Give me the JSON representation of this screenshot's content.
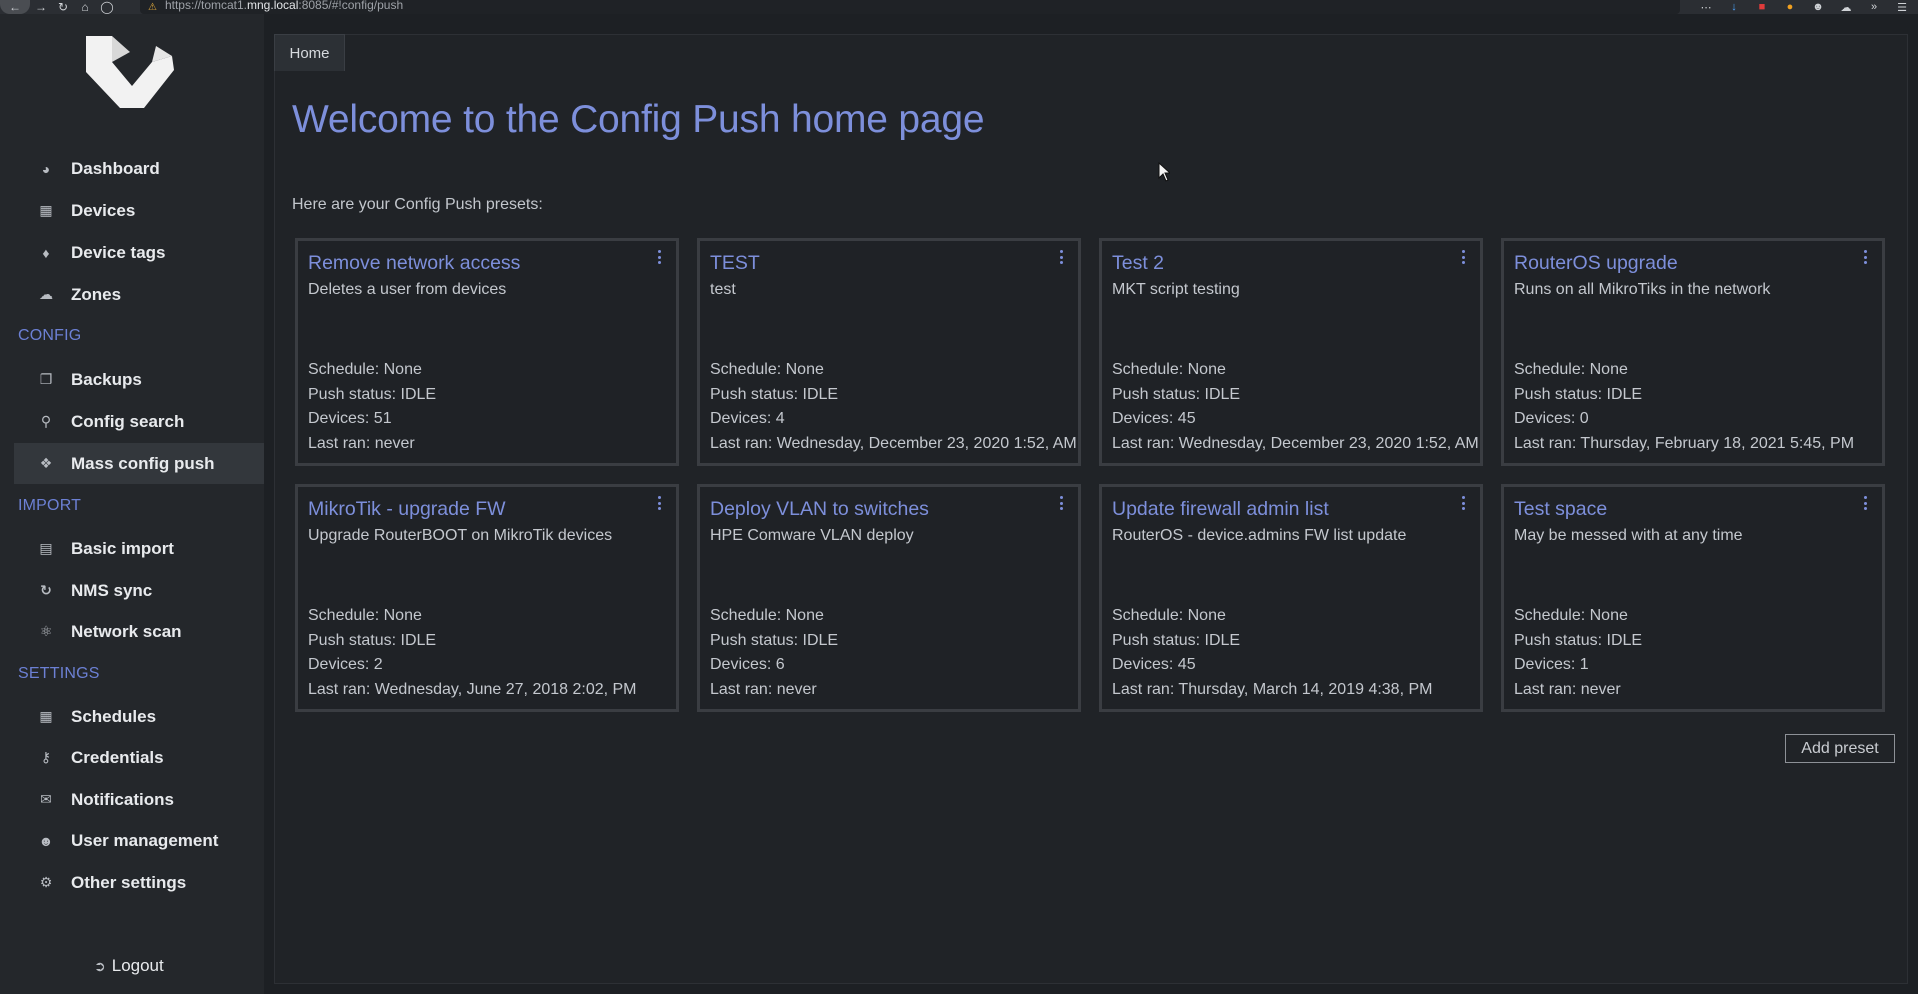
{
  "browser": {
    "url_prefix": "https://tomcat1.",
    "url_host": "mng.local",
    "url_suffix": ":8085/#!config/push"
  },
  "sidebar": {
    "items": [
      {
        "label": "Dashboard",
        "icon": "dashboard-icon"
      },
      {
        "label": "Devices",
        "icon": "table-icon"
      },
      {
        "label": "Device tags",
        "icon": "tags-icon"
      },
      {
        "label": "Zones",
        "icon": "cloud-icon"
      }
    ],
    "groups": [
      {
        "title": "CONFIG",
        "items": [
          {
            "label": "Backups",
            "icon": "copy-icon"
          },
          {
            "label": "Config search",
            "icon": "search-icon"
          },
          {
            "label": "Mass config push",
            "icon": "puzzle-icon",
            "active": true
          }
        ]
      },
      {
        "title": "IMPORT",
        "items": [
          {
            "label": "Basic import",
            "icon": "file-icon"
          },
          {
            "label": "NMS sync",
            "icon": "sync-icon"
          },
          {
            "label": "Network scan",
            "icon": "sitemap-icon"
          }
        ]
      },
      {
        "title": "SETTINGS",
        "items": [
          {
            "label": "Schedules",
            "icon": "calendar-icon"
          },
          {
            "label": "Credentials",
            "icon": "key-icon"
          },
          {
            "label": "Notifications",
            "icon": "envelope-icon"
          },
          {
            "label": "User management",
            "icon": "users-icon"
          },
          {
            "label": "Other settings",
            "icon": "cogs-icon"
          }
        ]
      }
    ],
    "logout_label": "Logout"
  },
  "breadcrumb": {
    "home": "Home"
  },
  "main": {
    "title": "Welcome to the Config Push home page",
    "intro": "Here are your Config Push presets:",
    "add_preset_label": "Add preset"
  },
  "presets": [
    {
      "title": "Remove network access",
      "desc": "Deletes a user from devices",
      "schedule": "Schedule: None",
      "status": "Push status: IDLE",
      "devices": "Devices: 51",
      "last_ran": "Last ran: never"
    },
    {
      "title": "TEST",
      "desc": "test",
      "schedule": "Schedule: None",
      "status": "Push status: IDLE",
      "devices": "Devices: 4",
      "last_ran": "Last ran: Wednesday, December 23, 2020 1:52, AM"
    },
    {
      "title": "Test 2",
      "desc": "MKT script testing",
      "schedule": "Schedule: None",
      "status": "Push status: IDLE",
      "devices": "Devices: 45",
      "last_ran": "Last ran: Wednesday, December 23, 2020 1:52, AM"
    },
    {
      "title": "RouterOS upgrade",
      "desc": "Runs on all MikroTiks in the network",
      "schedule": "Schedule: None",
      "status": "Push status: IDLE",
      "devices": "Devices: 0",
      "last_ran": "Last ran: Thursday, February 18, 2021 5:45, PM"
    },
    {
      "title": "MikroTik - upgrade FW",
      "desc": "Upgrade RouterBOOT on MikroTik devices",
      "schedule": "Schedule: None",
      "status": "Push status: IDLE",
      "devices": "Devices: 2",
      "last_ran": "Last ran: Wednesday, June 27, 2018 2:02, PM"
    },
    {
      "title": "Deploy VLAN to switches",
      "desc": "HPE Comware VLAN deploy",
      "schedule": "Schedule: None",
      "status": "Push status: IDLE",
      "devices": "Devices: 6",
      "last_ran": "Last ran: never"
    },
    {
      "title": "Update firewall admin list",
      "desc": "RouterOS - device.admins FW list update",
      "schedule": "Schedule: None",
      "status": "Push status: IDLE",
      "devices": "Devices: 45",
      "last_ran": "Last ran: Thursday, March 14, 2019 4:38, PM"
    },
    {
      "title": "Test space",
      "desc": "May be messed with at any time",
      "schedule": "Schedule: None",
      "status": "Push status: IDLE",
      "devices": "Devices: 1",
      "last_ran": "Last ran: never"
    }
  ]
}
